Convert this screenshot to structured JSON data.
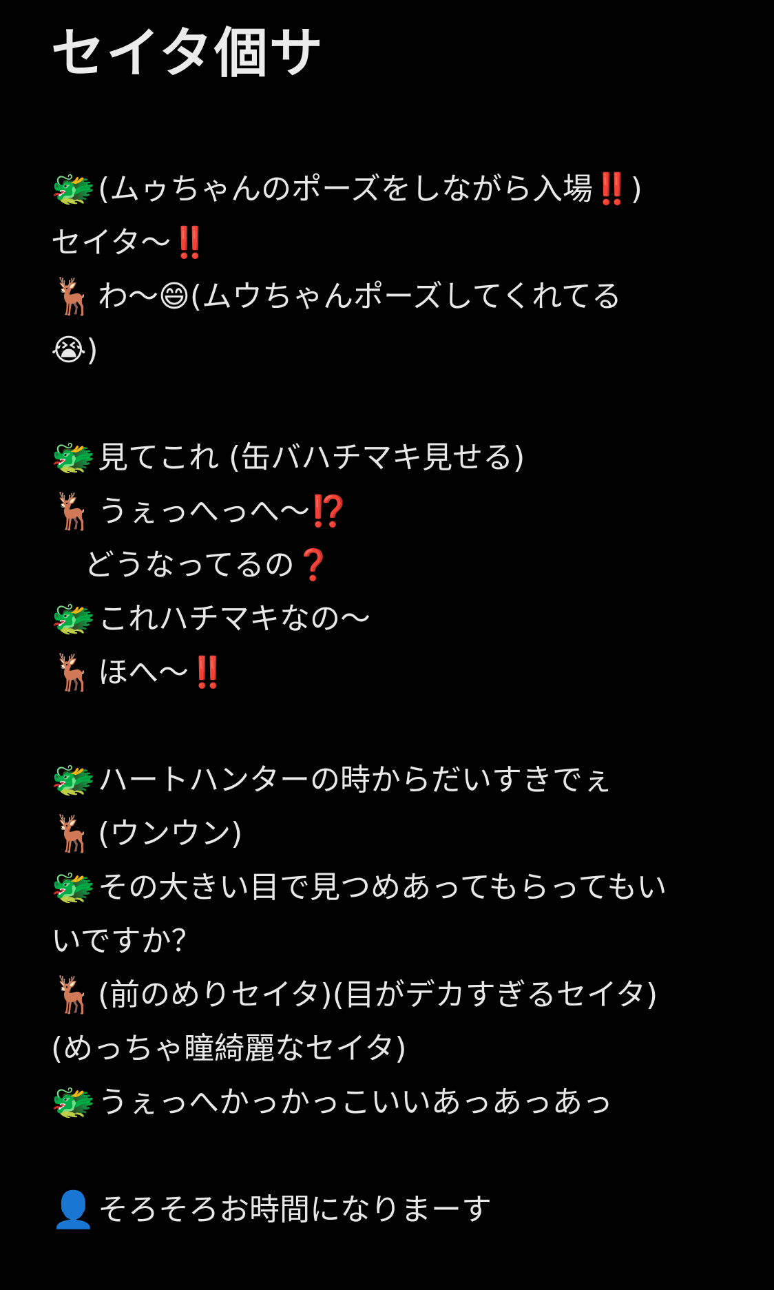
{
  "title": "セイタ個サ",
  "icons": {
    "dragon": "🐲",
    "deer": "🦌",
    "person": "👤"
  },
  "lines": [
    "(ムゥちゃんのポーズをしながら入場‼️)",
    "セイタ〜‼️",
    "わ〜😄(ムウちゃんポーズしてくれてる",
    "😭)",
    "見てこれ (缶バハチマキ見せる)",
    "うぇっへっへ〜⁉️",
    "どうなってるの❓",
    "これハチマキなの〜",
    "ほへ〜‼️",
    "ハートハンターの時からだいすきでぇ",
    "(ウンウン)",
    "その大きい目で見つめあってもらってもい",
    "いですか？",
    "(前のめりセイタ)(目がデカすぎるセイタ)",
    "(めっちゃ瞳綺麗なセイタ)",
    "うぇっへかっかっこいいあっあっあっ",
    "そろそろお時間になりまーす"
  ]
}
